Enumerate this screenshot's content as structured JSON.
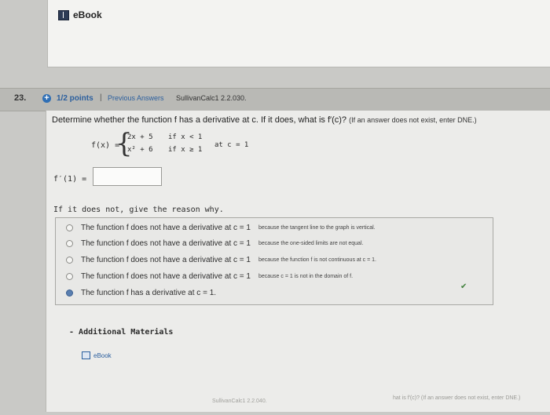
{
  "top": {
    "ebook_label": "eBook"
  },
  "question": {
    "number": "23.",
    "points": "1/2 points",
    "separator": "|",
    "previous_answers": "Previous Answers",
    "source": "SullivanCalc1 2.2.030.",
    "prompt": "Determine whether the function f has a derivative at c. If it does, what is f′(c)?",
    "prompt_note": "(If an answer does not exist, enter DNE.)"
  },
  "function": {
    "label": "f(x) =",
    "piece1_expr": "2x + 5",
    "piece1_cond": "if  x < 1",
    "piece2_expr": "x² + 6",
    "piece2_cond": "if  x ≥ 1",
    "at_c": "at c = 1"
  },
  "answer": {
    "label": "f′(1) =",
    "value": ""
  },
  "reason": {
    "label": "If it does not, give the reason why.",
    "options": [
      {
        "main": "The function f does not have a derivative at c = 1",
        "tail": "because the tangent line to the graph is vertical.",
        "selected": false
      },
      {
        "main": "The function f does not have a derivative at c = 1",
        "tail": "because the one-sided limits are not equal.",
        "selected": false
      },
      {
        "main": "The function f does not have a derivative at c = 1",
        "tail": "because the function f is not continuous at c = 1.",
        "selected": false
      },
      {
        "main": "The function f does not have a derivative at c = 1",
        "tail": "because c = 1 is not in the domain of f.",
        "selected": false
      },
      {
        "main": "The function f has a derivative at c = 1.",
        "tail": "",
        "selected": true
      }
    ]
  },
  "additional": {
    "label": "Additional Materials",
    "ebook_label": "eBook"
  },
  "footer": {
    "id_text": "SullivanCalc1 2.2.040.",
    "faded_text": "hat is f′(c)? (If an answer does not exist, enter DNE.)"
  },
  "colors": {
    "accent": "#2b5f9e",
    "selected_radio": "#5a7fb0",
    "check": "#3f7f3a"
  }
}
